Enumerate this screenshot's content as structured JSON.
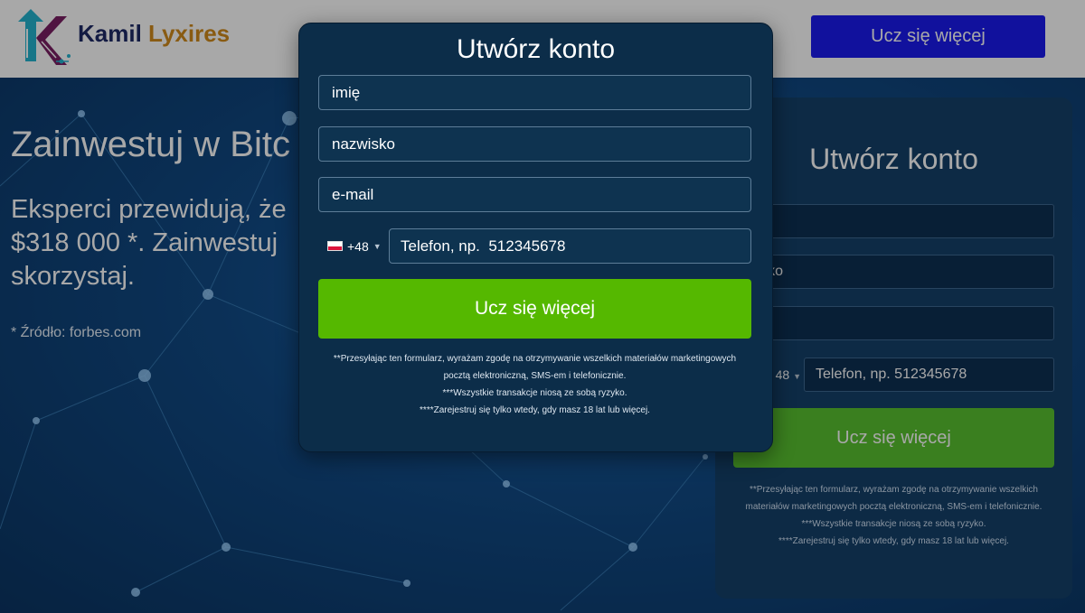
{
  "header": {
    "brand_first": "Kamil",
    "brand_second": "Lyxires",
    "cta_label": "Ucz się więcej",
    "logo_icon": "k-circuit-logo-icon"
  },
  "hero": {
    "title": "Zainwestuj w Bitc",
    "subtitle_lines": [
      "Eksperci przewidują, że",
      "$318 000 *. Zainwestuj",
      "skorzystaj."
    ],
    "source": "* Źródło: forbes.com"
  },
  "side_form": {
    "title": "Utwórz konto",
    "first_name": "e",
    "last_name": "wisko",
    "email": "ail",
    "phone_code": "48",
    "phone_placeholder": "Telefon, np.  512345678",
    "submit_label": "Ucz się więcej",
    "legal": [
      "**Przesyłając ten formularz, wyrażam zgodę na otrzymywanie wszelkich",
      "materiałów marketingowych pocztą elektroniczną, SMS-em i telefonicznie.",
      "***Wszystkie transakcje niosą ze sobą ryzyko.",
      "****Zarejestruj się tylko wtedy, gdy masz 18 lat lub więcej."
    ]
  },
  "modal": {
    "title": "Utwórz konto",
    "first_name_placeholder": "imię",
    "last_name_placeholder": "nazwisko",
    "email_placeholder": "e-mail",
    "phone_code": "+48",
    "phone_flag_icon": "poland-flag-icon",
    "phone_placeholder": "Telefon, np.  512345678",
    "submit_label": "Ucz się więcej",
    "legal": [
      "**Przesyłając ten formularz, wyrażam zgodę na otrzymywanie wszelkich materiałów marketingowych",
      "pocztą elektroniczną, SMS-em i telefonicznie.",
      "***Wszystkie transakcje niosą ze sobą ryzyko.",
      "****Zarejestruj się tylko wtedy, gdy masz 18 lat lub więcej."
    ]
  },
  "colors": {
    "header_cta": "#1a1aee",
    "submit_green": "#55b800",
    "brand_navy": "#1e2a66",
    "brand_gold": "#d08a1c",
    "modal_bg": "#0c2d49"
  }
}
